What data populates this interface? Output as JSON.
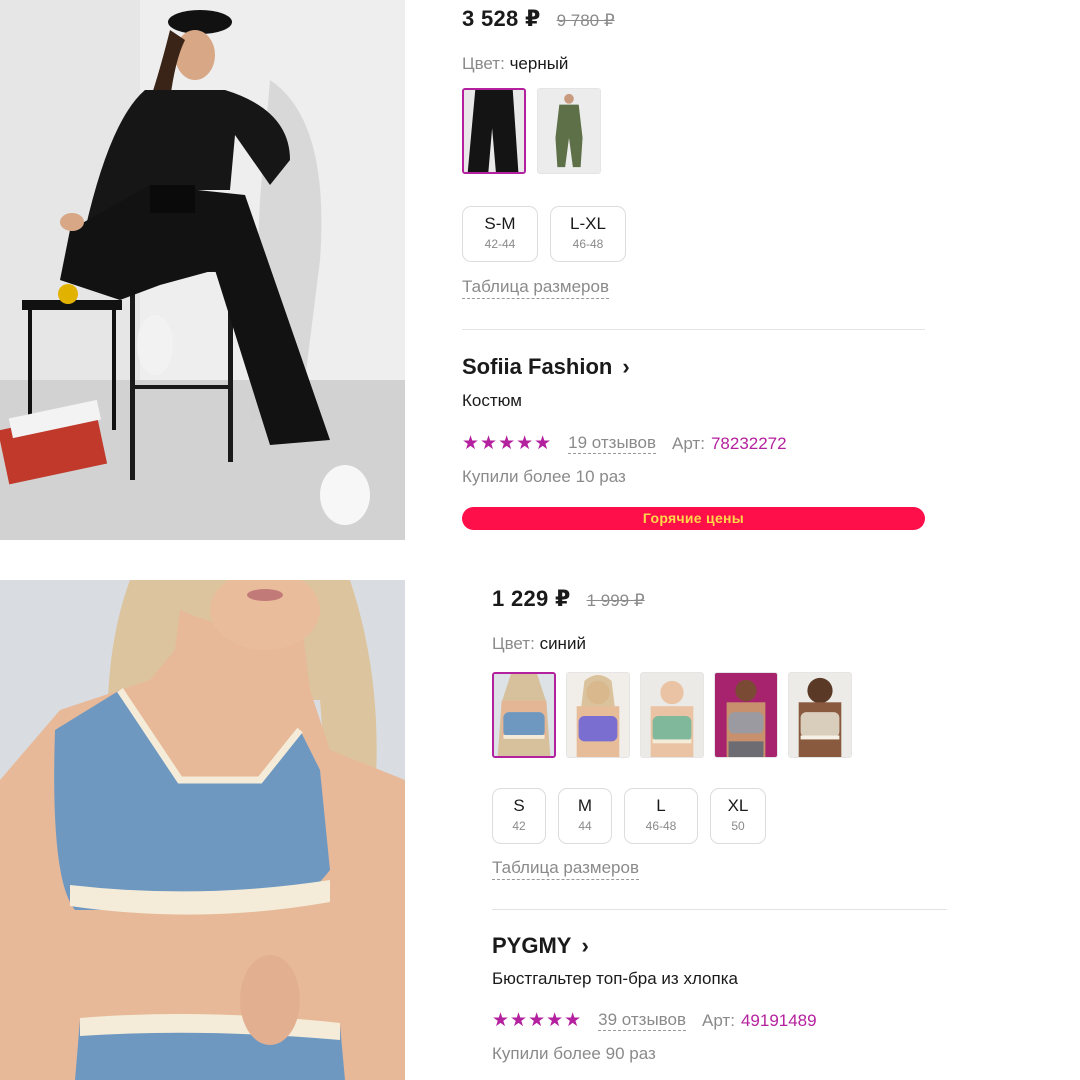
{
  "card1": {
    "price": "3 528 ₽",
    "old_price": "9 780 ₽",
    "color_label": "Цвет:",
    "color_value": "черный",
    "swatches": [
      "black-suit",
      "green-suit"
    ],
    "sizes": [
      {
        "label": "S-M",
        "range": "42-44"
      },
      {
        "label": "L-XL",
        "range": "46-48"
      }
    ],
    "size_table": "Таблица размеров",
    "brand": "Sofiia Fashion",
    "product_name": "Костюм",
    "rating_stars": "★★★★★",
    "reviews": "19 отзывов",
    "art_label": "Арт:",
    "art_value": "78232272",
    "bought": "Купили более 10 раз",
    "promo": "Горячие цены"
  },
  "card2": {
    "price": "1 229 ₽",
    "old_price": "1 999 ₽",
    "color_label": "Цвет:",
    "color_value": "синий",
    "swatches": [
      "blue-top",
      "purple-top",
      "green-top",
      "grey-top",
      "beige-top"
    ],
    "sizes": [
      {
        "label": "S",
        "range": "42"
      },
      {
        "label": "M",
        "range": "44"
      },
      {
        "label": "L",
        "range": "46-48"
      },
      {
        "label": "XL",
        "range": "50"
      }
    ],
    "size_table": "Таблица размеров",
    "brand": "PYGMY",
    "product_name": "Бюстгальтер топ-бра из хлопка",
    "rating_stars": "★★★★★",
    "reviews": "39 отзывов",
    "art_label": "Арт:",
    "art_value": "49191489",
    "bought": "Купили более 90 раз"
  },
  "colors": {
    "accent": "#b4219e",
    "promo_bg": "#ff0f4a",
    "promo_text": "#ffd84a",
    "muted": "#8a8a8a"
  },
  "icons": {
    "brand_link": "chevron-right-icon",
    "rating": "star-icon"
  }
}
